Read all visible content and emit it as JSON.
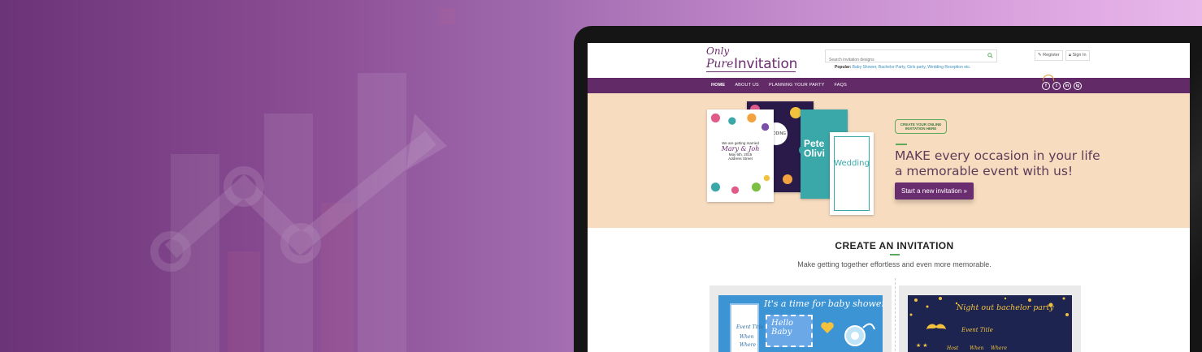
{
  "site": {
    "logo_only": "Only",
    "logo_pure": "Pure",
    "logo_invitation": "Invitation",
    "search_placeholder": "Search invitation designs",
    "popular_label": "Popular:",
    "popular_links": "Baby Shower, Bachelor Party, Girls party, Wedding Reception etc.",
    "register_label": "Register",
    "signin_label": "Sign In"
  },
  "nav": {
    "items": [
      {
        "label": "HOME",
        "active": true
      },
      {
        "label": "ABOUT US",
        "active": false
      },
      {
        "label": "PLANNING YOUR PARTY",
        "active": false
      },
      {
        "label": "FAQS",
        "active": false
      }
    ],
    "social": [
      "f",
      "t",
      "in",
      "ig"
    ]
  },
  "hero": {
    "badge": "CREATE YOUR ONLINE INVITATION HERE",
    "headline": "MAKE every occasion in your life a memorable event with us!",
    "cta": "Start a new invitation »",
    "card1_line1": "We are getting married",
    "card1_names": "Mary & Joh",
    "card1_date": "May 6th, 2015",
    "card1_address": "Address Street",
    "card2_badge": "WEDDING",
    "card3_names": "Pete Olivi",
    "card4_title": "Wedding"
  },
  "section": {
    "title": "CREATE AN INVITATION",
    "subtitle": "Make getting together effortless and even more memorable."
  },
  "tiles": [
    {
      "headline": "It's a time for baby shower!",
      "hello": "Hello Baby",
      "event": "Event Title",
      "when": "When",
      "where": "Where"
    },
    {
      "headline": "Night out bachelor party",
      "event": "Event Title",
      "host": "Host",
      "when": "When",
      "where": "Where"
    }
  ],
  "colors": {
    "brand_purple": "#622a66",
    "hero_bg": "#f7dcbf",
    "accent_green": "#5aaa5a"
  }
}
